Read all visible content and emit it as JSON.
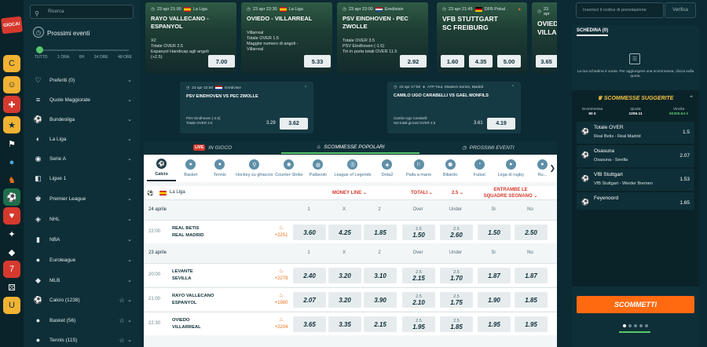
{
  "rail": {
    "logo": "GIOCA!"
  },
  "left": {
    "search_placeholder": "Ricerca",
    "section_title": "Prossimi eventi",
    "time_filters": [
      "TUTTO",
      "1 ORA",
      "6H",
      "24 ORE",
      "48 ORE"
    ],
    "time_filter_selected": 0,
    "items": [
      {
        "label": "Preferiti (0)",
        "icon": "heart-icon"
      },
      {
        "label": "Quote Maggiorate",
        "icon": "boost-icon"
      },
      {
        "label": "Bundesliga",
        "icon": "bundesliga-icon"
      },
      {
        "label": "La Liga",
        "icon": "laliga-icon"
      },
      {
        "label": "Serie A",
        "icon": "seriea-icon"
      },
      {
        "label": "Ligue 1",
        "icon": "ligue1-icon"
      },
      {
        "label": "Premier League",
        "icon": "premier-icon"
      },
      {
        "label": "NHL",
        "icon": "nhl-icon"
      },
      {
        "label": "NBA",
        "icon": "nba-icon"
      },
      {
        "label": "Euroleague",
        "icon": "euroleague-icon"
      },
      {
        "label": "MLB",
        "icon": "mlb-icon"
      },
      {
        "label": "Calcio (1238)",
        "icon": "soccer-icon"
      },
      {
        "label": "Basket (56)",
        "icon": "basketball-icon"
      },
      {
        "label": "Tennis (115)",
        "icon": "tennis-icon"
      }
    ]
  },
  "featured": [
    {
      "date": "23 apr 21:00",
      "league": "La Liga",
      "teams": "RAYO VALLECANO - ESPANYOL",
      "l1": "X2",
      "l2": "Totale OVER 2.5",
      "l3": "Espanyol Handicap agli angoli (+2.5)",
      "odd": "7.00"
    },
    {
      "date": "23 apr 22:30",
      "league": "La Liga",
      "teams": "OVIEDO - VILLARREAL",
      "l1": "Villarreal",
      "l2": "Totale OVER 1.5",
      "l3": "Maggior numero di angoli - Villarreal",
      "odd": "5.33"
    },
    {
      "date": "23 apr 22:00",
      "league": "Eredivisie",
      "teams": "PSV EINDHOVEN - PEC ZWOLLE",
      "l1": "Totale OVER 3.5",
      "l2": "PSV Eindhoven (-1.5)",
      "l3": "Tiri in porta totali OVER 11.5",
      "odd": "2.92"
    },
    {
      "date": "23 apr 21:45",
      "league": "DFB Pokal",
      "teams1": "VFB STUTTGART",
      "teams2": "SC FREIBURG",
      "o1": "1.60",
      "o2": "4.35",
      "o3": "5.00"
    },
    {
      "date": "23 apr",
      "teams1": "OVIEDO",
      "teams2": "VILLARR",
      "o1": "3.65"
    }
  ],
  "subcards": [
    {
      "date": "23 apr 22:00",
      "league": "Eredivisie",
      "teams": "PSV EINDHOVEN VS PEC ZWOLLE",
      "l1": "PSV Eindhoven (-2.5)",
      "l2": "Totale OVER 4.5",
      "old": "3.29",
      "odd": "3.62"
    },
    {
      "date": "23 apr 17:00",
      "league": "ATP Tour, Masters Series, Madrid",
      "teams": "CAMILO UGO CARABELLI VS GAEL MONFILS",
      "l1": "Camilo Ugo Carabelli",
      "l2": "Set totali giocati OVER 2.5",
      "old": "3.61",
      "odd": "4.19"
    }
  ],
  "tabs": {
    "live_badge": "LIVE",
    "live": "IN GIOCO",
    "popular": "SCOMMESSE POPOLARI",
    "upcoming": "PROSSIMI EVENTI"
  },
  "sports": [
    "Calcio",
    "Basket",
    "Tennis",
    "Hockey su ghiaccio",
    "Counter-Strike",
    "Pallavolo",
    "League of Legends",
    "Dota2",
    "Palla a mano",
    "Biliardo",
    "Futsal",
    "Lega di rugby",
    "Ru..."
  ],
  "odds": {
    "league": "La Liga",
    "market1": "MONEY LINE",
    "market2": "TOTALI",
    "market2_line": "2.5",
    "market3": "ENTRAMBE LE SQUADRE SEGNANO",
    "columns": [
      "1",
      "X",
      "2",
      "Over",
      "Under",
      "Si",
      "No"
    ],
    "days": [
      {
        "label": "24 aprile",
        "rows": [
          {
            "time": "22:00",
            "home": "REAL BETIS",
            "away": "REAL MADRID",
            "pop": "+2251",
            "odds": [
              "3.60",
              "4.25",
              "1.85",
              "1.50",
              "2.60",
              "1.50",
              "2.50"
            ],
            "lines": [
              "2.5",
              "2.5"
            ]
          }
        ]
      },
      {
        "label": "23 aprile",
        "rows": [
          {
            "time": "20:00",
            "home": "LEVANTE",
            "away": "SEVILLA",
            "pop": "+2278",
            "odds": [
              "2.40",
              "3.20",
              "3.10",
              "2.15",
              "1.70",
              "1.87",
              "1.87"
            ],
            "lines": [
              "2.5",
              "2.5"
            ]
          },
          {
            "time": "21:00",
            "home": "RAYO VALLECANO",
            "away": "ESPANYOL",
            "pop": "+1980",
            "odds": [
              "2.07",
              "3.20",
              "3.90",
              "2.10",
              "1.75",
              "1.90",
              "1.85"
            ],
            "lines": [
              "2.5",
              "2.5"
            ]
          },
          {
            "time": "22:30",
            "home": "OVIEDO",
            "away": "VILLARREAL",
            "pop": "+2204",
            "odds": [
              "3.65",
              "3.35",
              "2.15",
              "1.95",
              "1.85",
              "1.95",
              "1.95"
            ],
            "lines": [
              "2.5",
              "2.5"
            ]
          }
        ]
      }
    ]
  },
  "right": {
    "code_placeholder": "Inserisci il codice di prenotazione",
    "verify": "Verifica",
    "schedina_tab": "SCHEDINA (0)",
    "empty_msg": "La tua schedina è vuota. Per aggiungere una scommessa, clicca sulla quota.",
    "sugg_title": "SCOMMESSE SUGGERITE",
    "stat_labels": [
      "Scommessa",
      "Quota",
      "Vincita"
    ],
    "stat_values": [
      "50 €",
      "1206.11",
      "60305.64 €"
    ],
    "suggestions": [
      {
        "name": "Totale OVER",
        "match": "Real Betis - Real Madrid",
        "odd": "1.5"
      },
      {
        "name": "Osasuna",
        "match": "Osasuna - Sevilla",
        "odd": "2.07"
      },
      {
        "name": "VfB Stuttgart",
        "match": "VfB Stuttgart - Werder Bremen",
        "odd": "1.53"
      },
      {
        "name": "Feyenoord",
        "match": "",
        "odd": "1.65"
      }
    ],
    "bet_button": "SCOMMETTI"
  }
}
